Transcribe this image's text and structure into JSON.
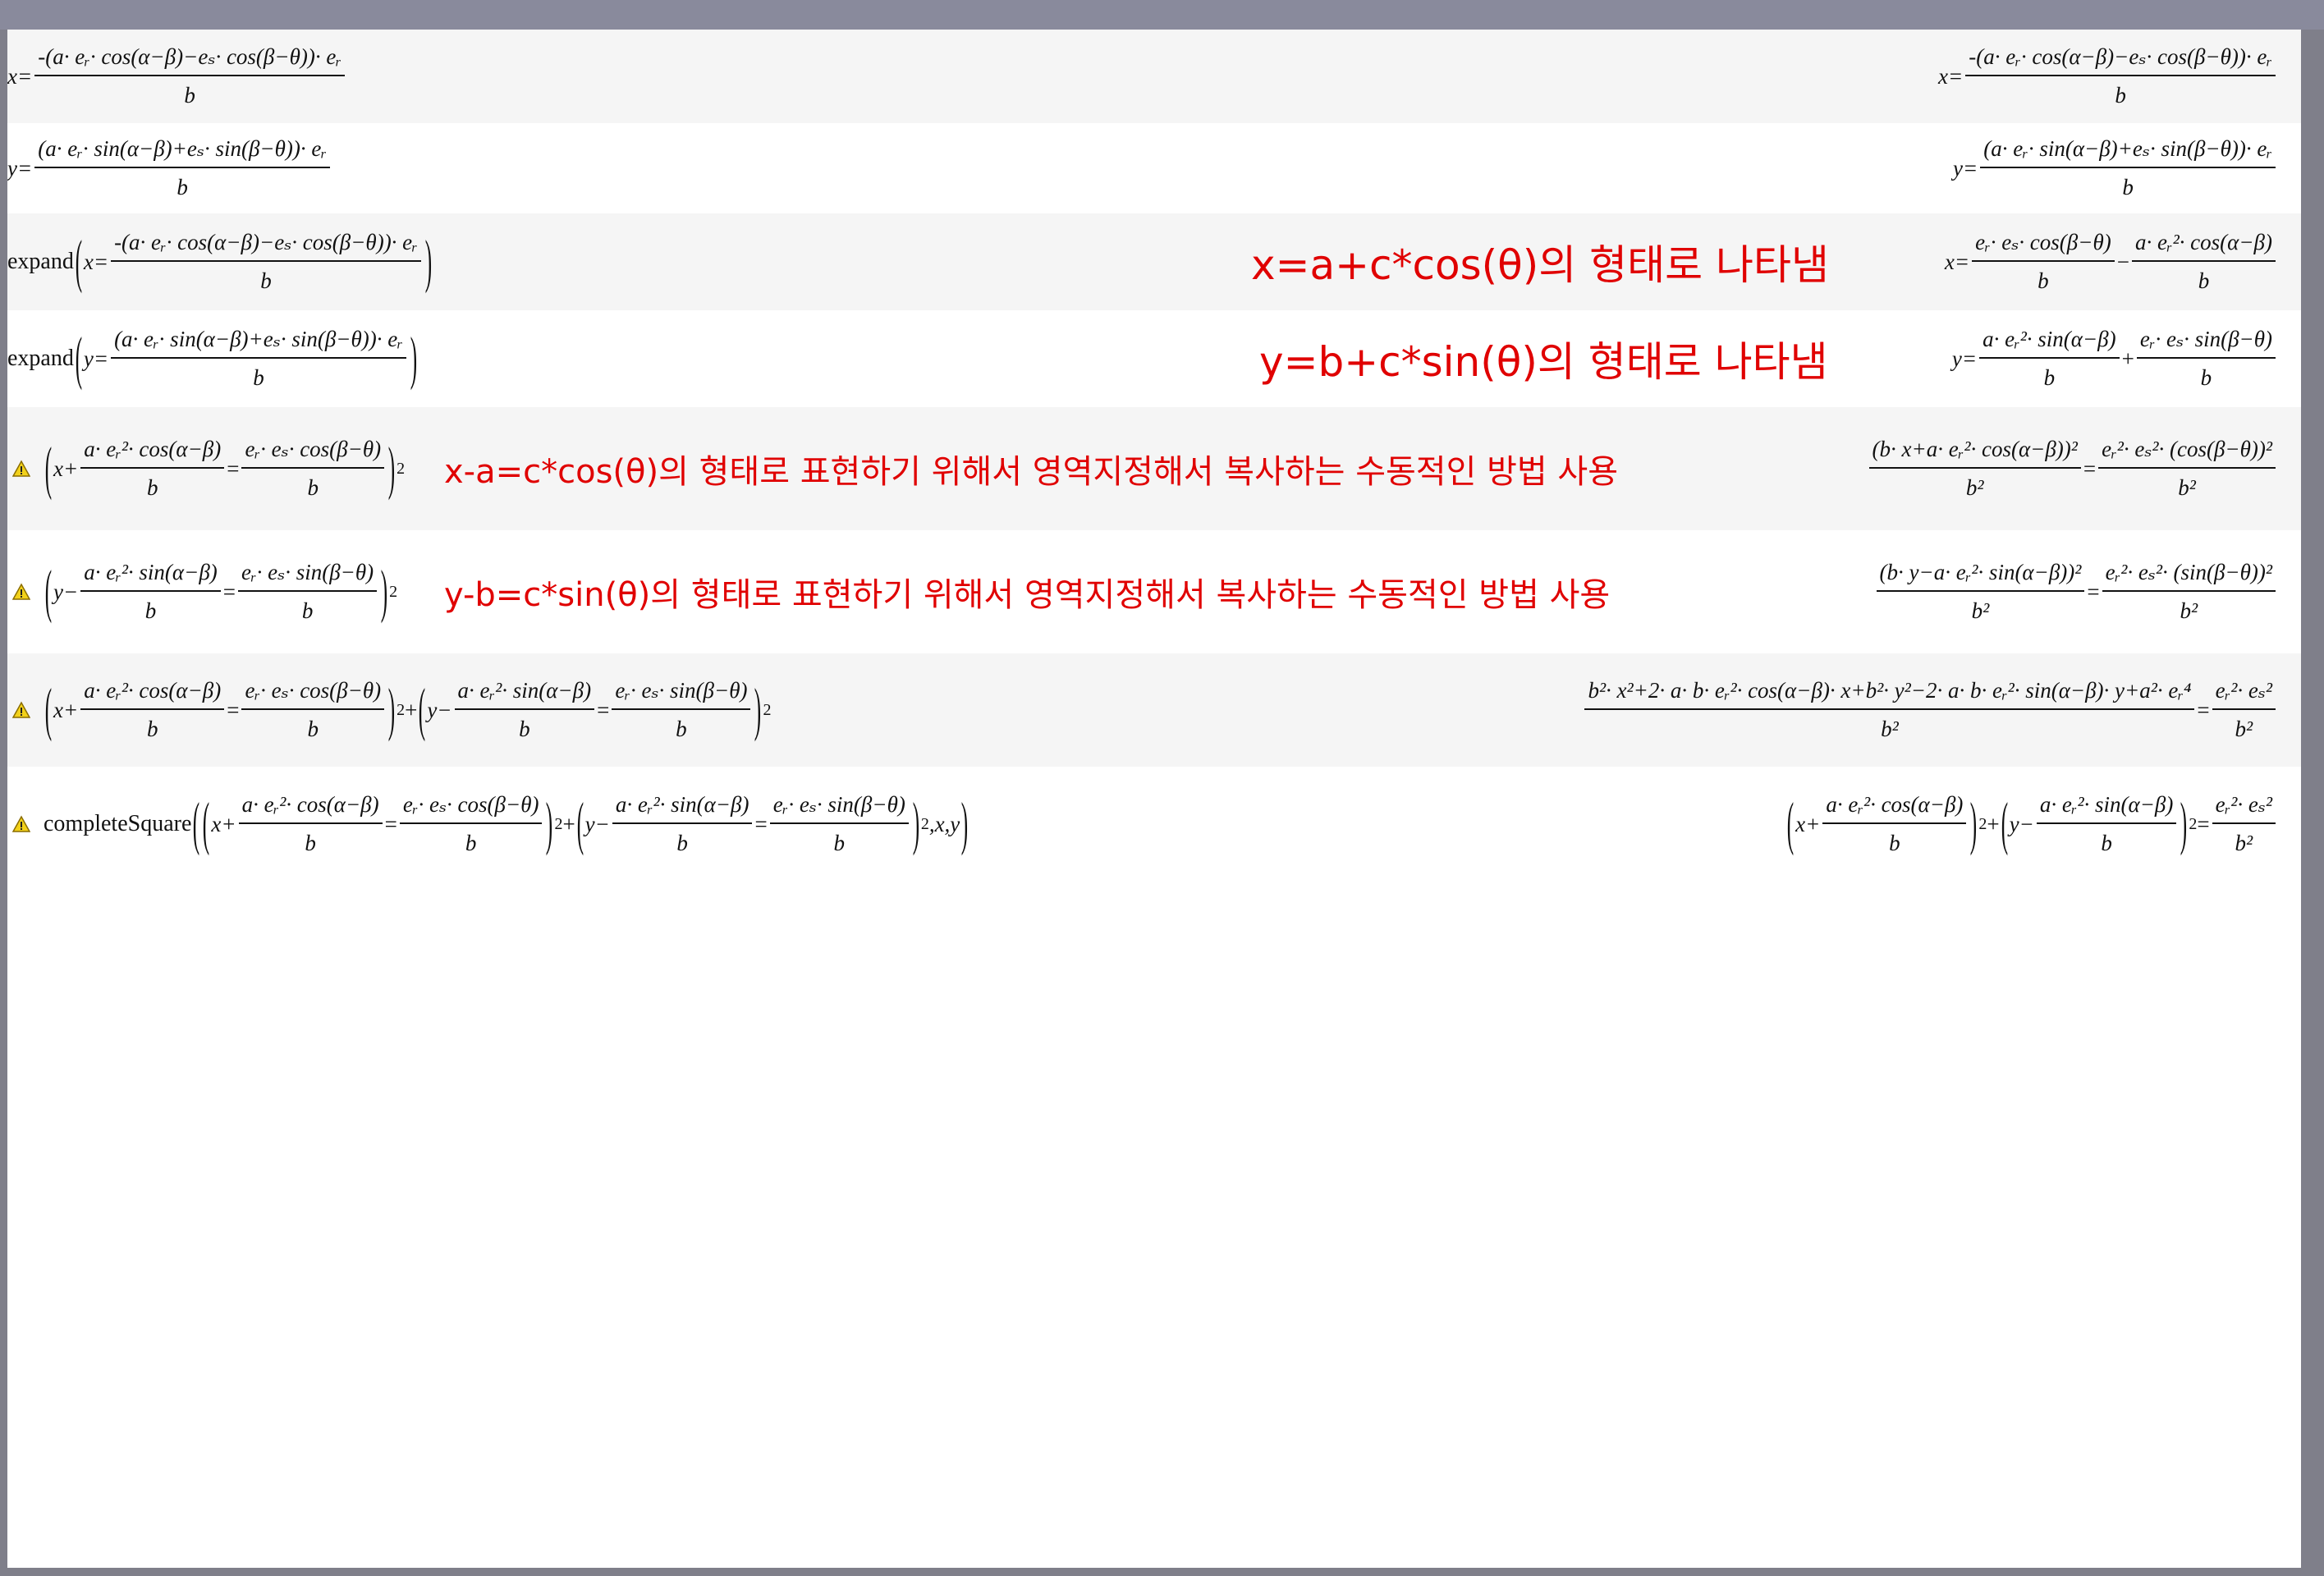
{
  "rows": [
    {
      "input": "x = -(a·e_r·cos(α−β) − e_s·cos(β−θ))·e_r / b",
      "in_num": "-(a· eᵣ· cos(α−β)−eₛ· cos(β−θ))· eᵣ",
      "in_lhs": "x=",
      "in_den": "b",
      "out_num": "-(a· eᵣ· cos(α−β)−eₛ· cos(β−θ))· eᵣ",
      "out_lhs": "x=",
      "out_den": "b"
    },
    {
      "in_lhs": "y=",
      "in_num": "(a· eᵣ· sin(α−β)+eₛ· sin(β−θ))· eᵣ",
      "in_den": "b",
      "out_lhs": "y=",
      "out_num": "(a· eᵣ· sin(α−β)+eₛ· sin(β−θ))· eᵣ",
      "out_den": "b"
    },
    {
      "cmd": "expand",
      "in_lhs": "x=",
      "in_num": "-(a· eᵣ· cos(α−β)−eₛ· cos(β−θ))· eᵣ",
      "in_den": "b",
      "note": "x=a+c*cos(θ)의 형태로 나타냄",
      "out_lhs": "x=",
      "out_num1": "eᵣ· eₛ· cos(β−θ)",
      "out_den1": "b",
      "out_op": "−",
      "out_num2": "a· eᵣ²· cos(α−β)",
      "out_den2": "b"
    },
    {
      "cmd": "expand",
      "in_lhs": "y=",
      "in_num": "(a· eᵣ· sin(α−β)+eₛ· sin(β−θ))· eᵣ",
      "in_den": "b",
      "note": "y=b+c*sin(θ)의 형태로 나타냄",
      "out_lhs": "y=",
      "out_num1": "a· eᵣ²· sin(α−β)",
      "out_den1": "b",
      "out_op": "+",
      "out_num2": "eᵣ· eₛ· sin(β−θ)",
      "out_den2": "b"
    },
    {
      "in_pre": "x+",
      "in_num1": "a· eᵣ²· cos(α−β)",
      "in_den1": "b",
      "in_eq": "=",
      "in_num2": "eᵣ· eₛ· cos(β−θ)",
      "in_den2": "b",
      "in_pow": "2",
      "note": "x-a=c*cos(θ)의 형태로 표현하기 위해서 영역지정해서 복사하는 수동적인 방법 사용",
      "out_num1": "(b· x+a· eᵣ²· cos(α−β))²",
      "out_den1": "b²",
      "out_eq": "=",
      "out_num2": "eᵣ²· eₛ²· (cos(β−θ))²",
      "out_den2": "b²"
    },
    {
      "in_pre": "y−",
      "in_num1": "a· eᵣ²· sin(α−β)",
      "in_den1": "b",
      "in_eq": "=",
      "in_num2": "eᵣ· eₛ· sin(β−θ)",
      "in_den2": "b",
      "in_pow": "2",
      "note": "y-b=c*sin(θ)의 형태로 표현하기 위해서 영역지정해서 복사하는 수동적인 방법 사용",
      "out_num1": "(b· y−a· eᵣ²· sin(α−β))²",
      "out_den1": "b²",
      "out_eq": "=",
      "out_num2": "eᵣ²· eₛ²· (sin(β−θ))²",
      "out_den2": "b²"
    },
    {
      "in_pre": "x+",
      "in_num1": "a· eᵣ²· cos(α−β)",
      "in_den1": "b",
      "in_eq": "=",
      "in_num2": "eᵣ· eₛ· cos(β−θ)",
      "in_den2": "b",
      "in_pow": "2",
      "in_plus": "+",
      "in_pre2": "y−",
      "in_num3": "a· eᵣ²· sin(α−β)",
      "in_den3": "b",
      "in_num4": "eᵣ· eₛ· sin(β−θ)",
      "in_den4": "b",
      "out_num1": "b²· x²+2· a· b· eᵣ²· cos(α−β)· x+b²· y²−2· a· b· eᵣ²· sin(α−β)· y+a²· eᵣ⁴",
      "out_den1": "b²",
      "out_eq": "=",
      "out_num2": "eᵣ²· eₛ²",
      "out_den2": "b²"
    },
    {
      "cmd": "completeSquare",
      "in_pre": "x+",
      "in_num1": "a· eᵣ²· cos(α−β)",
      "in_den1": "b",
      "in_eq": "=",
      "in_num2": "eᵣ· eₛ· cos(β−θ)",
      "in_den2": "b",
      "in_pow": "2",
      "in_plus": "+",
      "in_pre2": "y−",
      "in_num3": "a· eᵣ²· sin(α−β)",
      "in_den3": "b",
      "in_num4": "eᵣ· eₛ· sin(β−θ)",
      "in_den4": "b",
      "in_vars": ",x,y",
      "out_pre": "x+",
      "out_num1": "a· eᵣ²· cos(α−β)",
      "out_den1": "b",
      "out_pow": "2",
      "out_plus": "+",
      "out_pre2": "y−",
      "out_num2": "a· eᵣ²· sin(α−β)",
      "out_den2": "b",
      "out_eq": "=",
      "out_num3": "eᵣ²· eₛ²",
      "out_den3": "b²"
    }
  ],
  "colors": {
    "note": "#e00000",
    "warning": "#f2d11a",
    "alt_row": "#f5f5f5"
  },
  "icons": {
    "warning": "warning-icon"
  }
}
